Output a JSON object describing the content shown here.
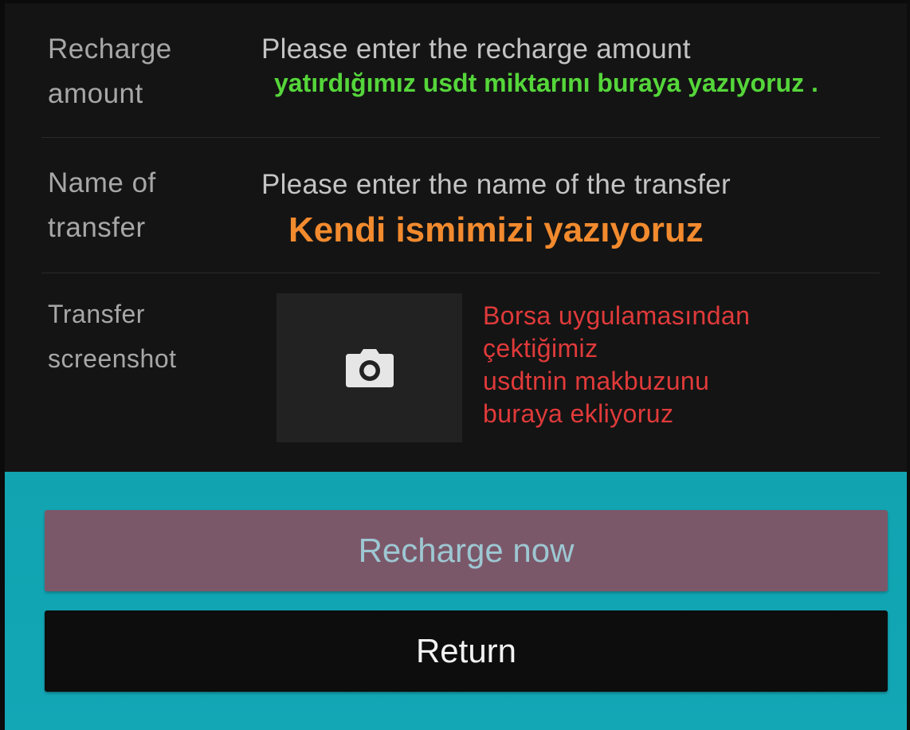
{
  "form": {
    "recharge_amount": {
      "label": "Recharge\namount",
      "placeholder": "Please enter the recharge amount",
      "annotation": "yatırdığımız usdt miktarını buraya yazıyoruz ."
    },
    "transfer_name": {
      "label": "Name of\ntransfer",
      "placeholder": "Please enter the name of the transfer",
      "annotation": "Kendi ismimizi yazıyoruz"
    },
    "transfer_screenshot": {
      "label": "Transfer\nscreenshot",
      "upload_icon": "camera-icon",
      "annotation": "Borsa uygulamasından\nçektiğimiz\nusdtnin makbuzunu\nburaya ekliyoruz"
    }
  },
  "actions": {
    "recharge_label": "Recharge now",
    "return_label": "Return"
  },
  "colors": {
    "panel_bg": "#141414",
    "actions_bg": "#12a3b0",
    "recharge_button_bg": "#7b5869",
    "recharge_button_text": "#9dc7d3",
    "return_button_bg": "#0d0d0e",
    "annotation_green": "#55d63a",
    "annotation_orange": "#f28a2e",
    "annotation_red": "#e03a3a"
  }
}
